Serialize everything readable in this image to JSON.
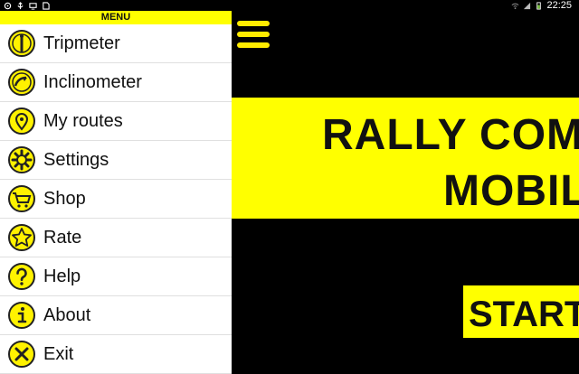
{
  "status_bar": {
    "time": "22:25",
    "icons": [
      "gps-icon",
      "usb-icon",
      "screen-icon",
      "sd-card-icon",
      "wifi-icon",
      "signal-icon",
      "battery-icon"
    ]
  },
  "menu": {
    "header": "MENU",
    "items": [
      {
        "label": "Tripmeter",
        "icon": "tripmeter-icon"
      },
      {
        "label": "Inclinometer",
        "icon": "inclinometer-icon"
      },
      {
        "label": "My routes",
        "icon": "map-pin-icon"
      },
      {
        "label": "Settings",
        "icon": "gear-icon"
      },
      {
        "label": "Shop",
        "icon": "cart-icon"
      },
      {
        "label": "Rate",
        "icon": "star-icon"
      },
      {
        "label": "Help",
        "icon": "question-icon"
      },
      {
        "label": "About",
        "icon": "info-icon"
      },
      {
        "label": "Exit",
        "icon": "close-icon"
      }
    ]
  },
  "main": {
    "title_line1": "RALLY COMPUTER",
    "title_line2": "MOBILE",
    "start_label": "START"
  },
  "colors": {
    "accent": "#ffff00",
    "background": "#000000",
    "drawer": "#ffffff",
    "icon_fill": "#fff200"
  }
}
